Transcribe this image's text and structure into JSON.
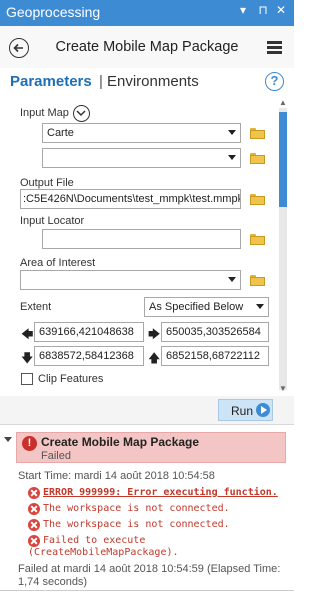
{
  "window": {
    "title": "Geoprocessing",
    "buttons": [
      "▾",
      "⊓",
      "✕"
    ]
  },
  "header": {
    "tool_title": "Create Mobile Map Package"
  },
  "tabs": {
    "parameters": "Parameters",
    "separator": "|",
    "environments": "Environments",
    "help": "?"
  },
  "params": {
    "input_map": {
      "label": "Input Map",
      "values": [
        "Carte",
        ""
      ]
    },
    "output_file": {
      "label": "Output File",
      "value": ":C5E426N\\Documents\\test_mmpk\\test.mmpk"
    },
    "input_locator": {
      "label": "Input Locator",
      "value": ""
    },
    "area_of_interest": {
      "label": "Area of Interest",
      "value": ""
    },
    "extent": {
      "label": "Extent",
      "mode": "As Specified Below",
      "left": "639166,421048638",
      "right": "650035,303526584",
      "bottom": "6838572,58412368",
      "top": "6852158,68722112"
    },
    "clip_features": {
      "label": "Clip Features",
      "checked": false
    }
  },
  "run": {
    "label": "Run"
  },
  "result": {
    "title": "Create Mobile Map Package",
    "status": "Failed",
    "start_time": "Start Time: mardi 14 août 2018 10:54:58",
    "errors": [
      "ERROR 999999: Error executing function.",
      "The workspace is not connected.",
      "The workspace is not connected.",
      "Failed to execute",
      "(CreateMobileMapPackage)."
    ],
    "failed_at_line1": "Failed at mardi 14 août 2018 10:54:59 (Elapsed Time:",
    "failed_at_line2": "1,74 seconds)"
  },
  "colors": {
    "accent": "#3c8bd3",
    "error": "#c9302c",
    "error_bg": "#f3c5c4"
  }
}
